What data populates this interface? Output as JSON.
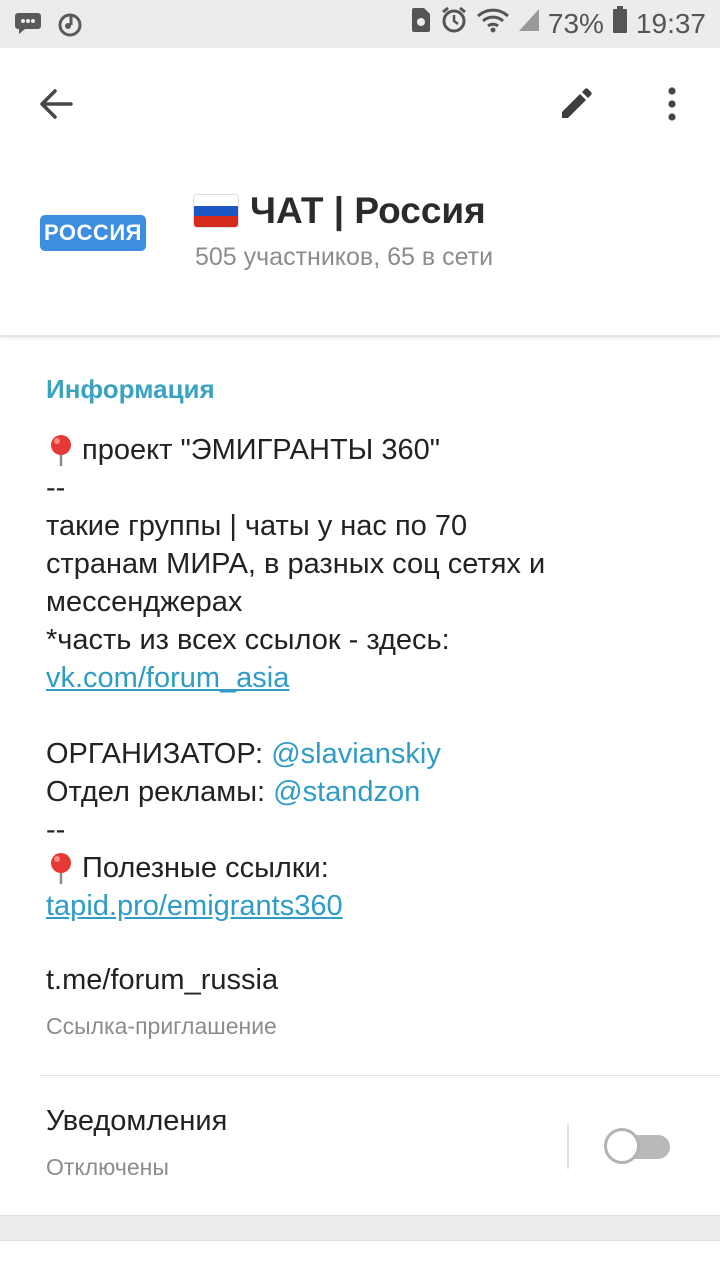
{
  "status_bar": {
    "battery": "73%",
    "time": "19:37",
    "left_icons": [
      "chat-bubble-icon",
      "music-note-icon"
    ],
    "right_icons": [
      "storage-icon",
      "alarm-icon",
      "wifi-icon",
      "signal-icon",
      "battery-icon"
    ]
  },
  "toolbar": {
    "back_icon": "arrow-left-icon",
    "edit_icon": "pencil-icon",
    "menu_icon": "more-vertical-icon"
  },
  "chat": {
    "avatar_text": "РОССИЯ",
    "title": "ЧАТ | Россия",
    "subtitle": "505 участников, 65 в сети",
    "flag_colors": [
      "#ffffff",
      "#1c57c4",
      "#d52b1e"
    ]
  },
  "info": {
    "heading": "Информация",
    "line1": "проект \"ЭМИГРАНТЫ 360\"",
    "sep1": "--",
    "line2": "такие группы | чаты у нас по 70",
    "line3": "странам МИРА, в разных соц сетях и",
    "line4": "мессенджерах",
    "line5": "*часть из всех ссылок - здесь:",
    "link1": "vk.com/forum_asia",
    "organizer_label": "ОРГАНИЗАТОР: ",
    "organizer_mention": "@slavianskiy",
    "ads_label": "Отдел рекламы: ",
    "ads_mention": "@standzon",
    "sep2": "--",
    "useful_label": "Полезные ссылки:",
    "link2": "tapid.pro/emigrants360"
  },
  "invite": {
    "link": "t.me/forum_russia",
    "label": "Ссылка-приглашение"
  },
  "notifications": {
    "label": "Уведомления",
    "status": "Отключены",
    "enabled": false
  },
  "colors": {
    "accent": "#3aa3c1",
    "link": "#2e9cc7",
    "avatar_bg": "#3c8ee0"
  }
}
